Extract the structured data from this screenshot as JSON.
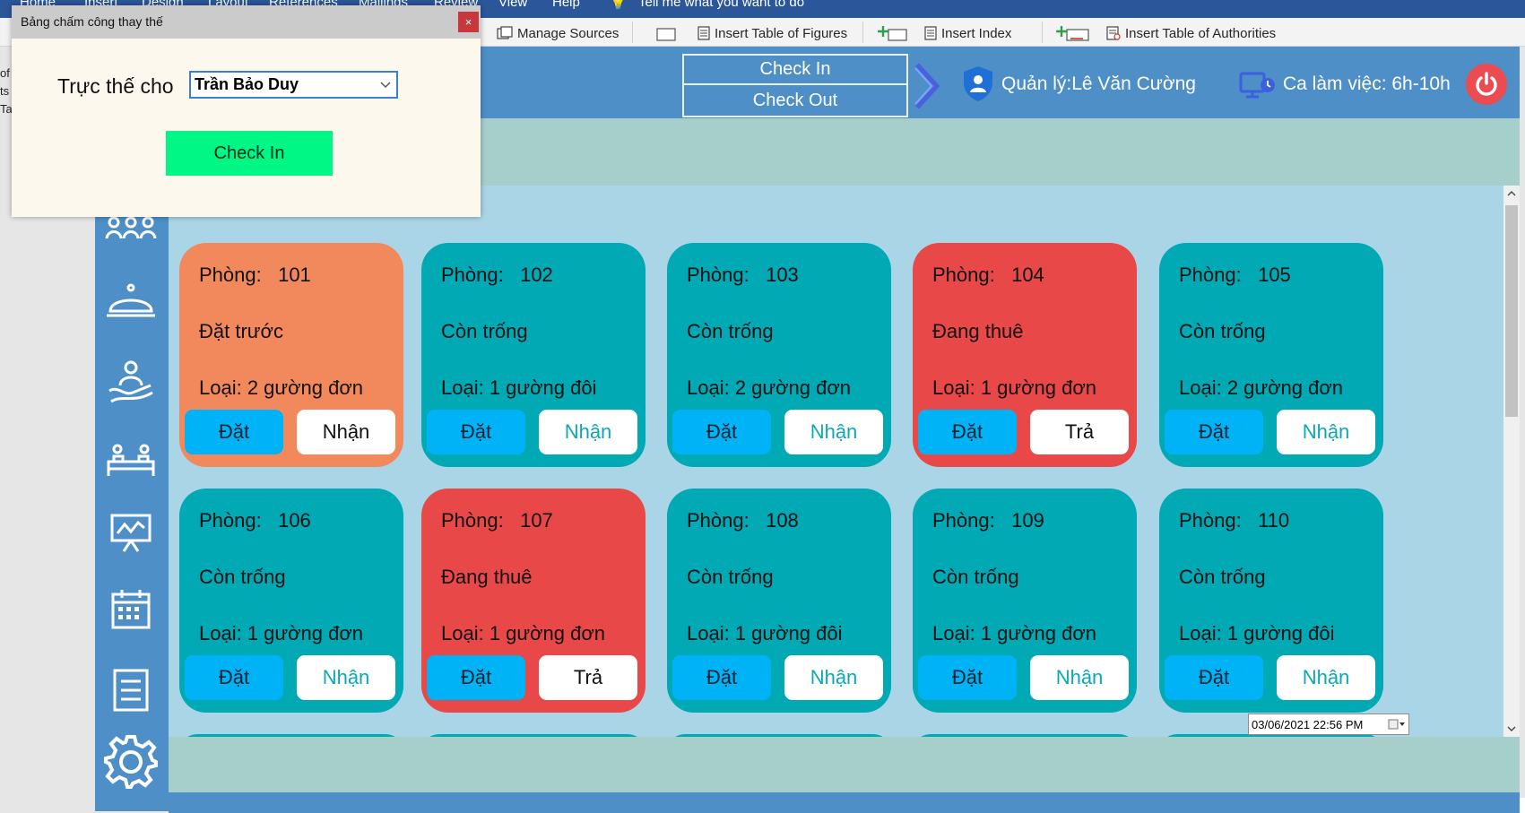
{
  "word": {
    "menu": [
      "Home",
      "Insert",
      "Design",
      "Layout",
      "References",
      "Mailings",
      "Review",
      "View",
      "Help",
      "Tell me what you want to do"
    ],
    "ribbon": {
      "manage_sources": "Manage Sources",
      "insert_table_of_figures": "Insert Table of Figures",
      "insert_index": "Insert Index",
      "insert_table_of_authorities": "Insert Table of Authorities"
    },
    "left_fragments": [
      "of",
      "ts",
      "Tal"
    ]
  },
  "header": {
    "check_in": "Check In",
    "check_out": "Check Out",
    "manager": "Quản lý:Lê Văn Cường",
    "shift": "Ca làm việc: 6h-10h"
  },
  "sidebar": {
    "icons": [
      "customers-icon",
      "service-bell-icon",
      "staff-icon",
      "rooms-icon",
      "statistics-icon",
      "calendar-icon",
      "report-icon",
      "settings-icon"
    ]
  },
  "rooms": [
    {
      "label": "Phòng:",
      "number": "101",
      "status": "Đặt trước",
      "type": "Loại: 2 gường đơn",
      "book": "Đặt",
      "action": "Nhận",
      "color": "#f2895c"
    },
    {
      "label": "Phòng:",
      "number": "102",
      "status": "Còn trống",
      "type": "Loại: 1 gường đôi",
      "book": "Đặt",
      "action": "Nhận",
      "color": "#00a9b4"
    },
    {
      "label": "Phòng:",
      "number": "103",
      "status": "Còn trống",
      "type": "Loại: 2 gường đơn",
      "book": "Đặt",
      "action": "Nhận",
      "color": "#00a9b4"
    },
    {
      "label": "Phòng:",
      "number": "104",
      "status": "Đang thuê",
      "type": "Loại: 1 gường đơn",
      "book": "Đặt",
      "action": "Trả",
      "color": "#e84848"
    },
    {
      "label": "Phòng:",
      "number": "105",
      "status": "Còn trống",
      "type": "Loại: 2 gường đơn",
      "book": "Đặt",
      "action": "Nhận",
      "color": "#00a9b4"
    },
    {
      "label": "Phòng:",
      "number": "106",
      "status": "Còn trống",
      "type": "Loại: 1 gường đơn",
      "book": "Đặt",
      "action": "Nhận",
      "color": "#00a9b4"
    },
    {
      "label": "Phòng:",
      "number": "107",
      "status": "Đang thuê",
      "type": "Loại: 1 gường đơn",
      "book": "Đặt",
      "action": "Trả",
      "color": "#e84848"
    },
    {
      "label": "Phòng:",
      "number": "108",
      "status": "Còn trống",
      "type": "Loại: 1 gường đôi",
      "book": "Đặt",
      "action": "Nhận",
      "color": "#00a9b4"
    },
    {
      "label": "Phòng:",
      "number": "109",
      "status": "Còn trống",
      "type": "Loại: 1 gường đơn",
      "book": "Đặt",
      "action": "Nhận",
      "color": "#00a9b4"
    },
    {
      "label": "Phòng:",
      "number": "110",
      "status": "Còn trống",
      "type": "Loại: 1 gường đôi",
      "book": "Đặt",
      "action": "Nhận",
      "color": "#00a9b4"
    }
  ],
  "footer": {
    "datetime": "03/06/2021 22:56 PM"
  },
  "dialog": {
    "title": "Bảng chấm công thay thế",
    "close": "×",
    "label": "Trực thế cho",
    "selected": "Trần Bảo Duy",
    "button": "Check In"
  },
  "colors": {
    "header_blue": "#4e8fc7",
    "vacant": "#00a9b4",
    "occupied": "#e84848",
    "reserved": "#f2895c",
    "book_button": "#00b3f7",
    "check_in_green": "#00f785"
  }
}
